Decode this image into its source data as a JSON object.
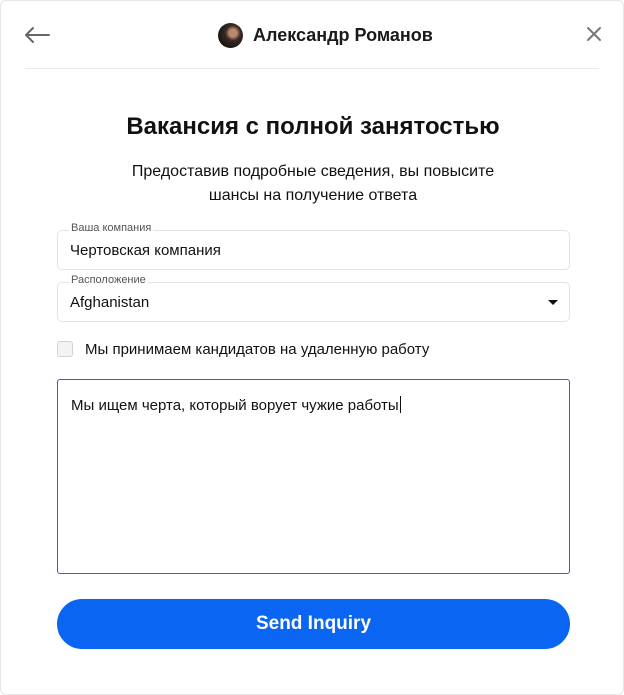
{
  "header": {
    "back_icon": "arrow-left-icon",
    "close_icon": "close-icon",
    "user_name": "Александр Романов"
  },
  "title": "Вакансия с полной занятостью",
  "subtitle": "Предоставив подробные сведения, вы повысите шансы на получение ответа",
  "company": {
    "label": "Ваша компания",
    "value": "Чертовская компания"
  },
  "location": {
    "label": "Расположение",
    "selected": "Afghanistan"
  },
  "remote_checkbox": {
    "label": "Мы принимаем кандидатов на удаленную работу",
    "checked": false
  },
  "description": {
    "value": "Мы ищем черта, который ворует чужие работы"
  },
  "send_button": {
    "label": "Send Inquiry",
    "color": "#0a66f2"
  }
}
